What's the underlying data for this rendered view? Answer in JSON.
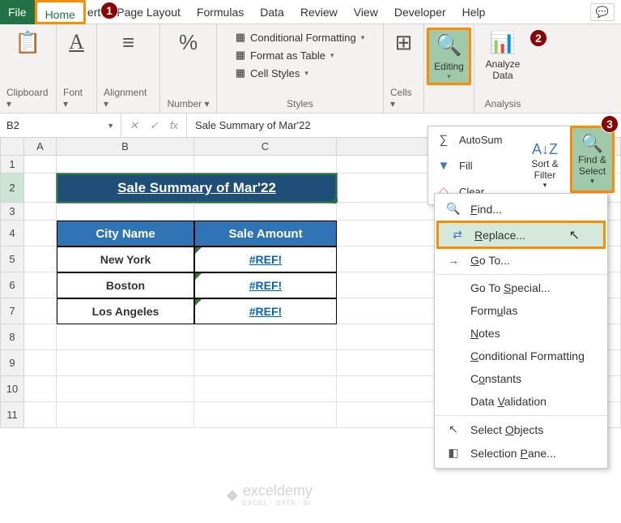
{
  "menu": {
    "file": "File",
    "home": "Home",
    "insert_partial": "ert",
    "page_layout": "Page Layout",
    "formulas": "Formulas",
    "data": "Data",
    "review": "Review",
    "view": "View",
    "developer": "Developer",
    "help": "Help"
  },
  "ribbon": {
    "clipboard": "Clipboard",
    "font": "Font",
    "alignment": "Alignment",
    "number": "Number",
    "styles": "Styles",
    "cells": "Cells",
    "editing": "Editing",
    "analysis": "Analysis",
    "cond_fmt": "Conditional Formatting",
    "fmt_table": "Format as Table",
    "cell_styles": "Cell Styles",
    "analyze_data": "Analyze\nData"
  },
  "edit_dropdown": {
    "autosum": "AutoSum",
    "fill": "Fill",
    "clear": "Clear"
  },
  "sort_filter": "Sort &\nFilter",
  "find_select": "Find &\nSelect",
  "fs_menu": {
    "find": "Find...",
    "replace": "Replace...",
    "goto": "Go To...",
    "goto_special": "Go To Special...",
    "formulas": "Formulas",
    "notes": "Notes",
    "cond_fmt": "Conditional Formatting",
    "constants": "Constants",
    "validation": "Data Validation",
    "sel_obj": "Select Objects",
    "sel_pane": "Selection Pane..."
  },
  "namebox": "B2",
  "formula": "Sale Summary of Mar'22",
  "cols": {
    "A": "A",
    "B": "B",
    "C": "C"
  },
  "rows": [
    "1",
    "2",
    "3",
    "4",
    "5",
    "6",
    "7",
    "8",
    "9",
    "10",
    "11"
  ],
  "title_cell": "Sale Summary of Mar'22",
  "headers": {
    "city": "City Name",
    "amount": "Sale Amount"
  },
  "data_rows": [
    {
      "city": "New York",
      "amount": "#REF!"
    },
    {
      "city": "Boston",
      "amount": "#REF!"
    },
    {
      "city": "Los Angeles",
      "amount": "#REF!"
    }
  ],
  "callouts": {
    "c1": "1",
    "c2": "2",
    "c3": "3"
  },
  "watermark": {
    "name": "exceldemy",
    "sub": "EXCEL · DATA · BI"
  }
}
